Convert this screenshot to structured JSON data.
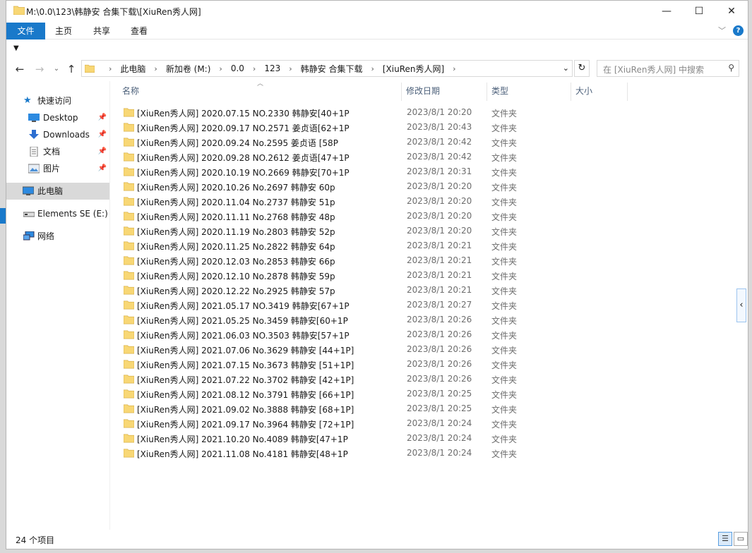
{
  "window": {
    "title": "M:\\0.0\\123\\韩静安 合集下载\\[XiuRen秀人网]",
    "controls": {
      "minimize": "—",
      "maximize": "☐",
      "close": "✕"
    }
  },
  "ribbon": {
    "tabs": [
      "文件",
      "主页",
      "共享",
      "查看"
    ],
    "help": "?"
  },
  "address": {
    "crumbs": [
      "此电脑",
      "新加卷 (M:)",
      "0.0",
      "123",
      "韩静安 合集下载",
      "[XiuRen秀人网]"
    ],
    "search_placeholder": "在 [XiuRen秀人网] 中搜索"
  },
  "nav": {
    "quick_access": "快速访问",
    "items": [
      {
        "label": "Desktop",
        "icon": "desktop-icon"
      },
      {
        "label": "Downloads",
        "icon": "downloads-icon"
      },
      {
        "label": "文档",
        "icon": "documents-icon"
      },
      {
        "label": "图片",
        "icon": "pictures-icon"
      }
    ],
    "this_pc": "此电脑",
    "drive": "Elements SE (E:)",
    "network": "网络"
  },
  "columns": {
    "name": "名称",
    "date": "修改日期",
    "type": "类型",
    "size": "大小"
  },
  "files": [
    {
      "name": "[XiuRen秀人网] 2020.07.15 NO.2330 韩静安[40+1P",
      "date": "2023/8/1 20:20",
      "type": "文件夹"
    },
    {
      "name": "[XiuRen秀人网] 2020.09.17 NO.2571 姜贞语[62+1P",
      "date": "2023/8/1 20:43",
      "type": "文件夹"
    },
    {
      "name": "[XiuRen秀人网] 2020.09.24 No.2595 姜贞语 [58P",
      "date": "2023/8/1 20:42",
      "type": "文件夹"
    },
    {
      "name": "[XiuRen秀人网] 2020.09.28 NO.2612 姜贞语[47+1P",
      "date": "2023/8/1 20:42",
      "type": "文件夹"
    },
    {
      "name": "[XiuRen秀人网] 2020.10.19 NO.2669 韩静安[70+1P",
      "date": "2023/8/1 20:31",
      "type": "文件夹"
    },
    {
      "name": "[XiuRen秀人网] 2020.10.26 No.2697 韩静安 60p",
      "date": "2023/8/1 20:20",
      "type": "文件夹"
    },
    {
      "name": "[XiuRen秀人网] 2020.11.04 No.2737 韩静安 51p",
      "date": "2023/8/1 20:20",
      "type": "文件夹"
    },
    {
      "name": "[XiuRen秀人网] 2020.11.11 No.2768 韩静安 48p",
      "date": "2023/8/1 20:20",
      "type": "文件夹"
    },
    {
      "name": "[XiuRen秀人网] 2020.11.19 No.2803 韩静安 52p",
      "date": "2023/8/1 20:20",
      "type": "文件夹"
    },
    {
      "name": "[XiuRen秀人网] 2020.11.25 No.2822 韩静安 64p",
      "date": "2023/8/1 20:21",
      "type": "文件夹"
    },
    {
      "name": "[XiuRen秀人网] 2020.12.03 No.2853 韩静安 66p",
      "date": "2023/8/1 20:21",
      "type": "文件夹"
    },
    {
      "name": "[XiuRen秀人网] 2020.12.10 No.2878 韩静安 59p",
      "date": "2023/8/1 20:21",
      "type": "文件夹"
    },
    {
      "name": "[XiuRen秀人网] 2020.12.22 No.2925 韩静安 57p",
      "date": "2023/8/1 20:21",
      "type": "文件夹"
    },
    {
      "name": "[XiuRen秀人网] 2021.05.17 NO.3419 韩静安[67+1P",
      "date": "2023/8/1 20:27",
      "type": "文件夹"
    },
    {
      "name": "[XiuRen秀人网] 2021.05.25 No.3459 韩静安[60+1P",
      "date": "2023/8/1 20:26",
      "type": "文件夹"
    },
    {
      "name": "[XiuRen秀人网] 2021.06.03 NO.3503 韩静安[57+1P",
      "date": "2023/8/1 20:26",
      "type": "文件夹"
    },
    {
      "name": "[XiuRen秀人网] 2021.07.06 No.3629 韩静安 [44+1P]",
      "date": "2023/8/1 20:26",
      "type": "文件夹"
    },
    {
      "name": "[XiuRen秀人网] 2021.07.15 No.3673 韩静安 [51+1P]",
      "date": "2023/8/1 20:26",
      "type": "文件夹"
    },
    {
      "name": "[XiuRen秀人网] 2021.07.22 No.3702 韩静安 [42+1P]",
      "date": "2023/8/1 20:26",
      "type": "文件夹"
    },
    {
      "name": "[XiuRen秀人网] 2021.08.12 No.3791 韩静安 [66+1P]",
      "date": "2023/8/1 20:25",
      "type": "文件夹"
    },
    {
      "name": "[XiuRen秀人网] 2021.09.02 No.3888 韩静安 [68+1P]",
      "date": "2023/8/1 20:25",
      "type": "文件夹"
    },
    {
      "name": "[XiuRen秀人网] 2021.09.17 No.3964 韩静安 [72+1P]",
      "date": "2023/8/1 20:24",
      "type": "文件夹"
    },
    {
      "name": "[XiuRen秀人网] 2021.10.20 No.4089 韩静安[47+1P",
      "date": "2023/8/1 20:24",
      "type": "文件夹"
    },
    {
      "name": "[XiuRen秀人网] 2021.11.08 No.4181 韩静安[48+1P",
      "date": "2023/8/1 20:24",
      "type": "文件夹"
    }
  ],
  "status": {
    "count": "24 个项目"
  },
  "colors": {
    "accent": "#1979ca",
    "folder": "#f8d775",
    "selection": "#d9d9d9"
  }
}
